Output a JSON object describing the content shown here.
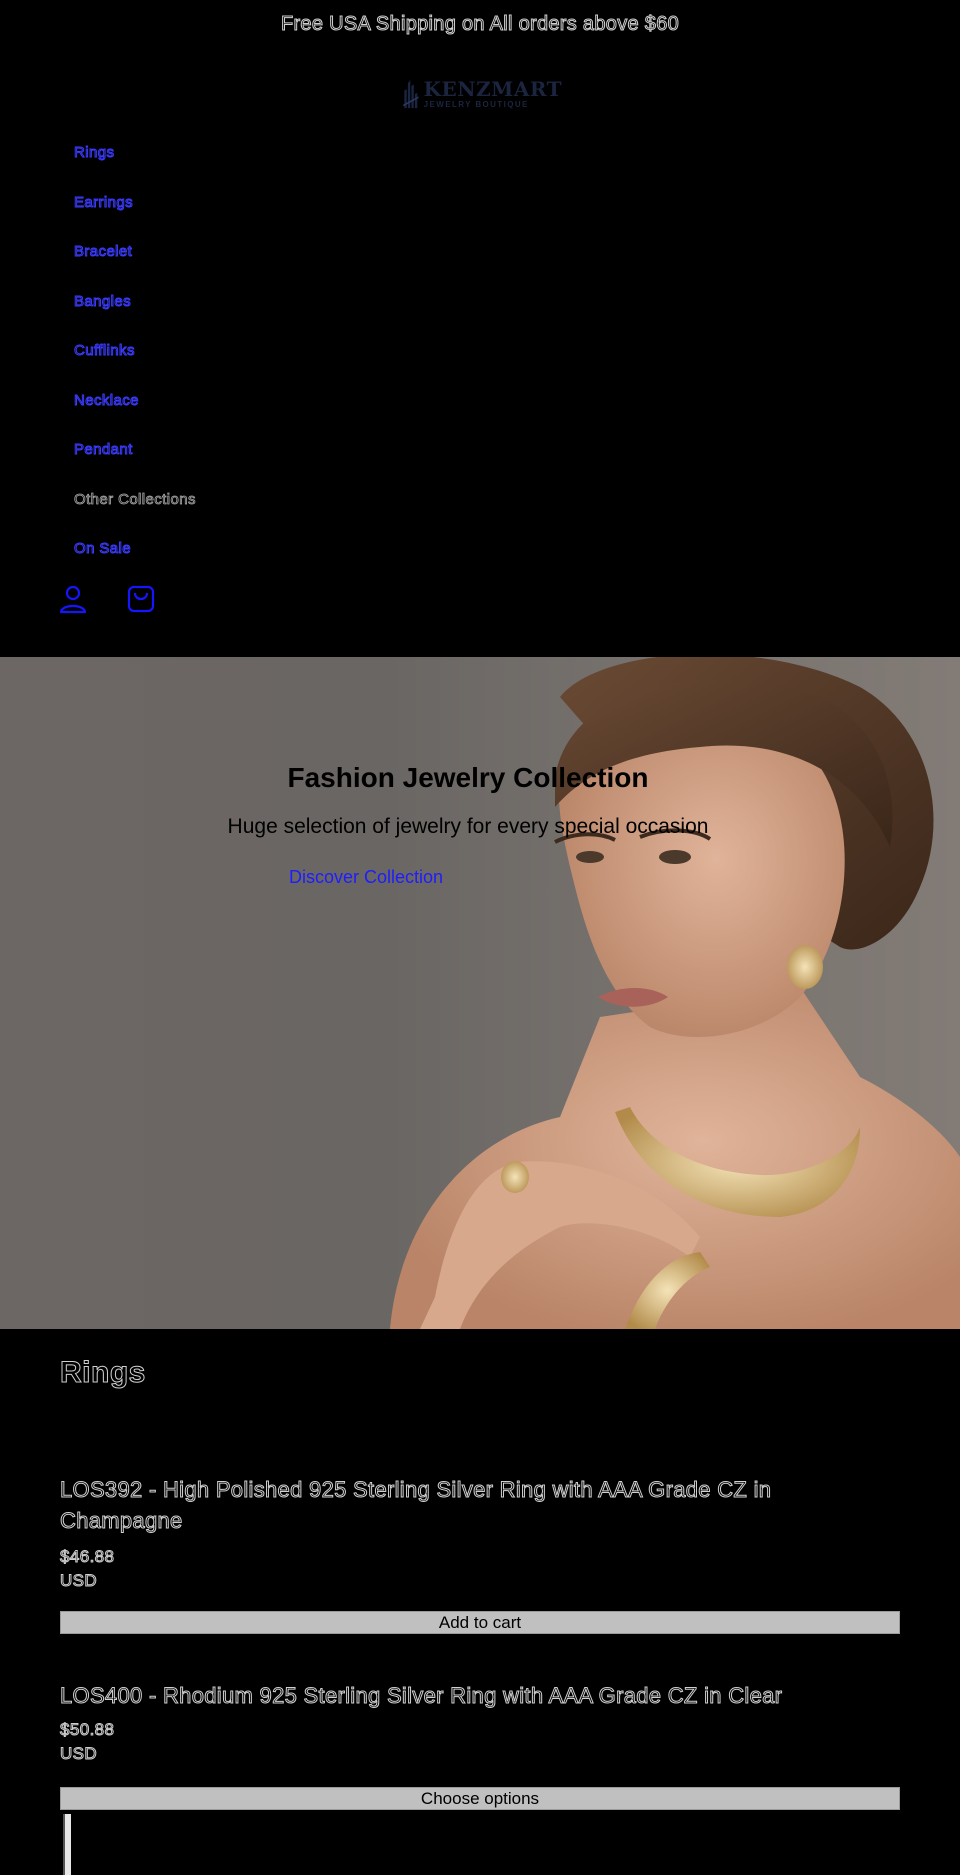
{
  "announcement": "Free USA Shipping on All orders above $60",
  "logo": {
    "name": "KENZMART",
    "tagline": "JEWELRY BOUTIQUE"
  },
  "nav": {
    "items": [
      {
        "label": "Rings",
        "style": "link"
      },
      {
        "label": "Earrings",
        "style": "link"
      },
      {
        "label": "Bracelet",
        "style": "link"
      },
      {
        "label": "Bangles",
        "style": "link"
      },
      {
        "label": "Cufflinks",
        "style": "link"
      },
      {
        "label": "Necklace",
        "style": "link"
      },
      {
        "label": "Pendant",
        "style": "link"
      },
      {
        "label": "Other Collections",
        "style": "plain"
      },
      {
        "label": "On Sale",
        "style": "link"
      }
    ]
  },
  "header_icons": [
    "account-icon",
    "cart-icon"
  ],
  "hero": {
    "title": "Fashion Jewelry Collection",
    "subtitle": "Huge selection of jewelry for every special occasion",
    "cta": "Discover Collection"
  },
  "collection": {
    "title": "Rings",
    "products": [
      {
        "title": "LOS392 - High Polished 925 Sterling Silver Ring with AAA Grade CZ in Champagne",
        "price": "$46.88",
        "currency": "USD",
        "button": "Add to cart"
      },
      {
        "title": "LOS400 - Rhodium 925 Sterling Silver Ring with AAA Grade CZ in Clear",
        "price": "$50.88",
        "currency": "USD",
        "button": "Choose options"
      }
    ]
  },
  "colors": {
    "background": "#000000",
    "link": "#3b3bff",
    "button": "#c0c0c0",
    "logo": "#1c2540"
  }
}
